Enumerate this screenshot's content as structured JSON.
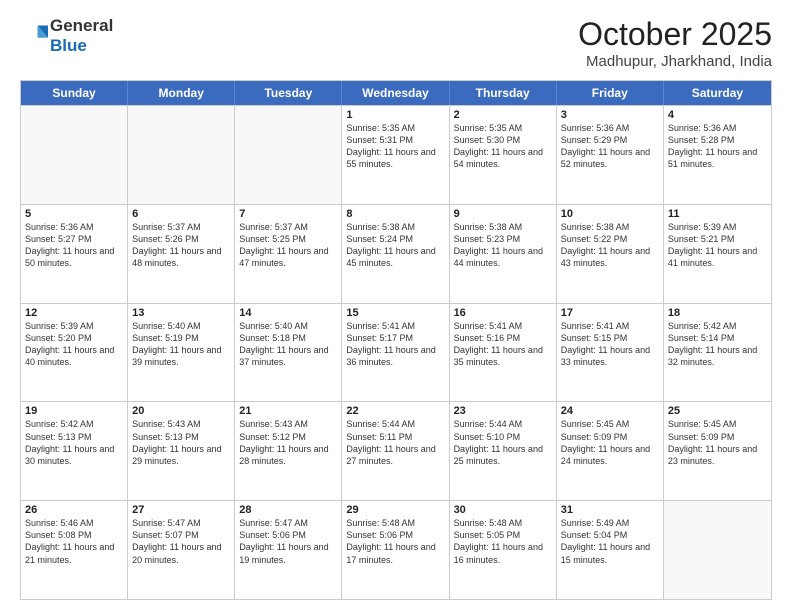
{
  "header": {
    "logo_general": "General",
    "logo_blue": "Blue",
    "month_title": "October 2025",
    "subtitle": "Madhupur, Jharkhand, India"
  },
  "calendar": {
    "days_of_week": [
      "Sunday",
      "Monday",
      "Tuesday",
      "Wednesday",
      "Thursday",
      "Friday",
      "Saturday"
    ],
    "rows": [
      [
        {
          "day": "",
          "empty": true
        },
        {
          "day": "",
          "empty": true
        },
        {
          "day": "",
          "empty": true
        },
        {
          "day": "1",
          "rise": "5:35 AM",
          "set": "5:31 PM",
          "daylight": "11 hours and 55 minutes."
        },
        {
          "day": "2",
          "rise": "5:35 AM",
          "set": "5:30 PM",
          "daylight": "11 hours and 54 minutes."
        },
        {
          "day": "3",
          "rise": "5:36 AM",
          "set": "5:29 PM",
          "daylight": "11 hours and 52 minutes."
        },
        {
          "day": "4",
          "rise": "5:36 AM",
          "set": "5:28 PM",
          "daylight": "11 hours and 51 minutes."
        }
      ],
      [
        {
          "day": "5",
          "rise": "5:36 AM",
          "set": "5:27 PM",
          "daylight": "11 hours and 50 minutes."
        },
        {
          "day": "6",
          "rise": "5:37 AM",
          "set": "5:26 PM",
          "daylight": "11 hours and 48 minutes."
        },
        {
          "day": "7",
          "rise": "5:37 AM",
          "set": "5:25 PM",
          "daylight": "11 hours and 47 minutes."
        },
        {
          "day": "8",
          "rise": "5:38 AM",
          "set": "5:24 PM",
          "daylight": "11 hours and 45 minutes."
        },
        {
          "day": "9",
          "rise": "5:38 AM",
          "set": "5:23 PM",
          "daylight": "11 hours and 44 minutes."
        },
        {
          "day": "10",
          "rise": "5:38 AM",
          "set": "5:22 PM",
          "daylight": "11 hours and 43 minutes."
        },
        {
          "day": "11",
          "rise": "5:39 AM",
          "set": "5:21 PM",
          "daylight": "11 hours and 41 minutes."
        }
      ],
      [
        {
          "day": "12",
          "rise": "5:39 AM",
          "set": "5:20 PM",
          "daylight": "11 hours and 40 minutes."
        },
        {
          "day": "13",
          "rise": "5:40 AM",
          "set": "5:19 PM",
          "daylight": "11 hours and 39 minutes."
        },
        {
          "day": "14",
          "rise": "5:40 AM",
          "set": "5:18 PM",
          "daylight": "11 hours and 37 minutes."
        },
        {
          "day": "15",
          "rise": "5:41 AM",
          "set": "5:17 PM",
          "daylight": "11 hours and 36 minutes."
        },
        {
          "day": "16",
          "rise": "5:41 AM",
          "set": "5:16 PM",
          "daylight": "11 hours and 35 minutes."
        },
        {
          "day": "17",
          "rise": "5:41 AM",
          "set": "5:15 PM",
          "daylight": "11 hours and 33 minutes."
        },
        {
          "day": "18",
          "rise": "5:42 AM",
          "set": "5:14 PM",
          "daylight": "11 hours and 32 minutes."
        }
      ],
      [
        {
          "day": "19",
          "rise": "5:42 AM",
          "set": "5:13 PM",
          "daylight": "11 hours and 30 minutes."
        },
        {
          "day": "20",
          "rise": "5:43 AM",
          "set": "5:13 PM",
          "daylight": "11 hours and 29 minutes."
        },
        {
          "day": "21",
          "rise": "5:43 AM",
          "set": "5:12 PM",
          "daylight": "11 hours and 28 minutes."
        },
        {
          "day": "22",
          "rise": "5:44 AM",
          "set": "5:11 PM",
          "daylight": "11 hours and 27 minutes."
        },
        {
          "day": "23",
          "rise": "5:44 AM",
          "set": "5:10 PM",
          "daylight": "11 hours and 25 minutes."
        },
        {
          "day": "24",
          "rise": "5:45 AM",
          "set": "5:09 PM",
          "daylight": "11 hours and 24 minutes."
        },
        {
          "day": "25",
          "rise": "5:45 AM",
          "set": "5:09 PM",
          "daylight": "11 hours and 23 minutes."
        }
      ],
      [
        {
          "day": "26",
          "rise": "5:46 AM",
          "set": "5:08 PM",
          "daylight": "11 hours and 21 minutes."
        },
        {
          "day": "27",
          "rise": "5:47 AM",
          "set": "5:07 PM",
          "daylight": "11 hours and 20 minutes."
        },
        {
          "day": "28",
          "rise": "5:47 AM",
          "set": "5:06 PM",
          "daylight": "11 hours and 19 minutes."
        },
        {
          "day": "29",
          "rise": "5:48 AM",
          "set": "5:06 PM",
          "daylight": "11 hours and 17 minutes."
        },
        {
          "day": "30",
          "rise": "5:48 AM",
          "set": "5:05 PM",
          "daylight": "11 hours and 16 minutes."
        },
        {
          "day": "31",
          "rise": "5:49 AM",
          "set": "5:04 PM",
          "daylight": "11 hours and 15 minutes."
        },
        {
          "day": "",
          "empty": true
        }
      ]
    ]
  }
}
